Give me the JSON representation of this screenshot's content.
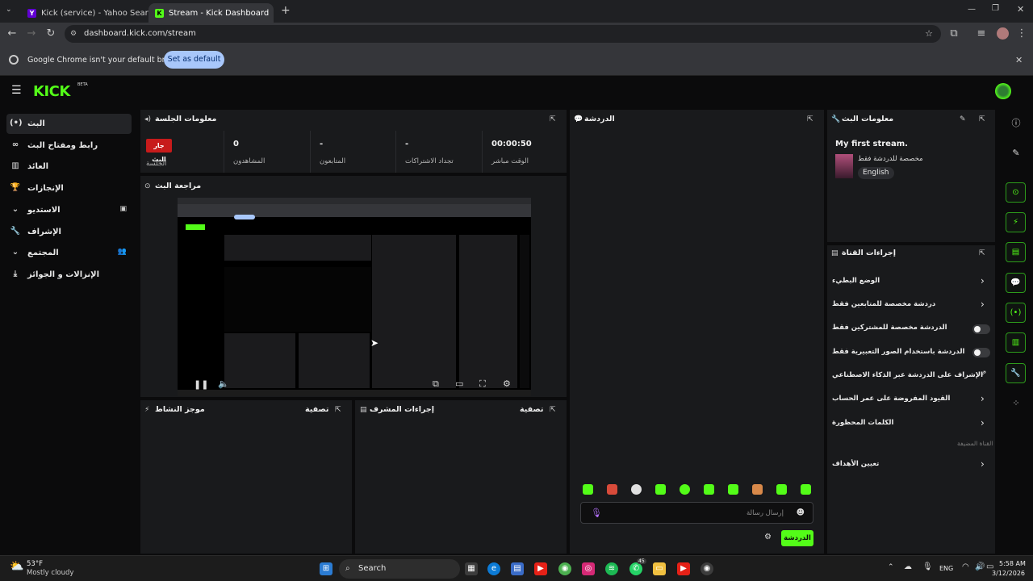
{
  "browser": {
    "tabs": [
      {
        "title": "Kick (service) - Yahoo Search Re",
        "active": false
      },
      {
        "title": "Stream - Kick Dashboard",
        "active": true
      }
    ],
    "url": "dashboard.kick.com/stream",
    "infobar": {
      "message": "Google Chrome isn't your default browser",
      "button": "Set as default"
    }
  },
  "kick": {
    "logo": "KICK",
    "beta": "BETA"
  },
  "sidebar": {
    "items": [
      {
        "label": "البث",
        "icon": "broadcast-icon"
      },
      {
        "label": "رابط ومفتاح البث",
        "icon": "link-icon"
      },
      {
        "label": "العائد",
        "icon": "chart-icon"
      },
      {
        "label": "الإنجازات",
        "icon": "trophy-icon"
      },
      {
        "label": "الاستديو",
        "icon": "chevron-down-icon"
      },
      {
        "label": "الإشراف",
        "icon": "wrench-icon"
      },
      {
        "label": "المجتمع",
        "icon": "chevron-down-icon"
      },
      {
        "label": "الإنزالات و الجوائز",
        "icon": "drops-icon"
      }
    ]
  },
  "session": {
    "title": "معلومات الجلسة",
    "badge": "جار البث",
    "badge_label": "الجلسة",
    "stats": [
      {
        "value": "0",
        "label": "المشاهدون"
      },
      {
        "value": "-",
        "label": "المتابعون"
      },
      {
        "value": "-",
        "label": "تجداد الاشتراكات"
      },
      {
        "value": "00:00:50",
        "label": "الوقت مباشر"
      }
    ]
  },
  "preview": {
    "title": "مراجعة البث"
  },
  "activity": {
    "title": "موجز النشاط",
    "filter": "تصفية"
  },
  "modactions": {
    "title": "إجراءات المشرف",
    "filter": "تصفية"
  },
  "chat": {
    "title": "الدردشة",
    "placeholder": "إرسال رسالة",
    "send": "الدردشة"
  },
  "stream_info": {
    "title": "معلومات البث",
    "stream_title": "My first stream.",
    "category": "مخصصة للدردشة فقط",
    "language": "English"
  },
  "channel_actions": {
    "title": "إجراءات القناة",
    "items": [
      {
        "label": "الوضع البطيء",
        "control": "chevron"
      },
      {
        "label": "دردشة مخصصة للمتابعين فقط",
        "control": "chevron"
      },
      {
        "label": "الدردشة مخصصة للمشتركين فقط",
        "control": "toggle"
      },
      {
        "label": "الدردشة باستخدام الصور التعبيرية فقط",
        "control": "toggle"
      },
      {
        "label": "الإشراف على الدردشة عبر الذكاء الاصطناعي",
        "control": "external"
      },
      {
        "label": "القيود المفروضة على عمر الحساب",
        "control": "chevron"
      },
      {
        "label": "الكلمات المحظورة",
        "control": "chevron"
      }
    ],
    "section": "القناة المضيفة",
    "goals": "تعيين الأهداف"
  },
  "taskbar": {
    "weather_temp": "53°F",
    "weather_desc": "Mostly cloudy",
    "search": "Search",
    "lang": "ENG",
    "time": "5:58 AM",
    "date": "3/12/2026",
    "badge_count": "45"
  },
  "colors": {
    "accent": "#53fc18",
    "live": "#c71b1b"
  }
}
